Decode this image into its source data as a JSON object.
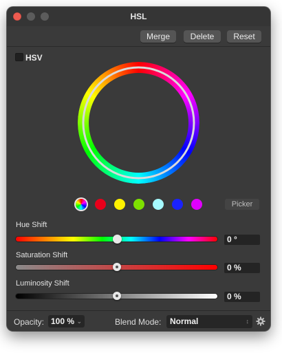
{
  "window": {
    "title": "HSL"
  },
  "toolbar": {
    "merge_label": "Merge",
    "delete_label": "Delete",
    "reset_label": "Reset"
  },
  "hsv": {
    "label": "HSV",
    "checked": false
  },
  "color_range_swatches": [
    {
      "name": "master",
      "color": "multi"
    },
    {
      "name": "red",
      "color": "#e8001b"
    },
    {
      "name": "yellow",
      "color": "#fff200"
    },
    {
      "name": "green",
      "color": "#7ee000"
    },
    {
      "name": "cyan",
      "color": "#a6fbff"
    },
    {
      "name": "blue",
      "color": "#1a22ff"
    },
    {
      "name": "magenta",
      "color": "#e000ff"
    }
  ],
  "picker_label": "Picker",
  "sliders": {
    "hue": {
      "label": "Hue Shift",
      "value": "0 °",
      "level": 0.5
    },
    "saturation": {
      "label": "Saturation Shift",
      "value": "0 %",
      "level": 0.5
    },
    "luminosity": {
      "label": "Luminosity Shift",
      "value": "0 %",
      "level": 0.5
    }
  },
  "footer": {
    "opacity_label": "Opacity:",
    "opacity_value": "100 %",
    "blend_label": "Blend Mode:",
    "blend_value": "Normal"
  },
  "colors": {
    "panel_bg": "#3a3a3a",
    "close_button": "#ee5b50"
  }
}
